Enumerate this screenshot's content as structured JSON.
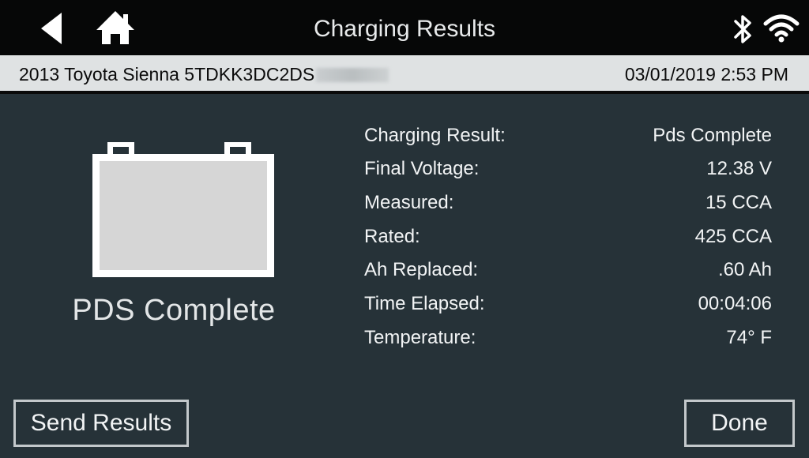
{
  "header": {
    "title": "Charging Results",
    "back_icon": "back-arrow-icon",
    "home_icon": "home-icon",
    "bluetooth_icon": "bluetooth-icon",
    "wifi_icon": "wifi-icon"
  },
  "infobar": {
    "vehicle": "2013 Toyota Sienna  5TDKK3DC2DS",
    "datetime": "03/01/2019 2:53 PM"
  },
  "battery": {
    "icon": "battery-icon",
    "status": "PDS Complete"
  },
  "results": [
    {
      "label": "Charging Result:",
      "value": "Pds Complete"
    },
    {
      "label": "Final Voltage:",
      "value": "12.38 V"
    },
    {
      "label": "Measured:",
      "value": "15 CCA"
    },
    {
      "label": "Rated:",
      "value": "425 CCA"
    },
    {
      "label": "Ah Replaced:",
      "value": ".60 Ah"
    },
    {
      "label": "Time Elapsed:",
      "value": "00:04:06"
    },
    {
      "label": "Temperature:",
      "value": "74° F"
    }
  ],
  "buttons": {
    "send": "Send Results",
    "done": "Done"
  },
  "colors": {
    "background": "#263238",
    "topbar": "#060707",
    "infobar": "#dfe2e3",
    "battery_fill": "#d6d6d6"
  }
}
